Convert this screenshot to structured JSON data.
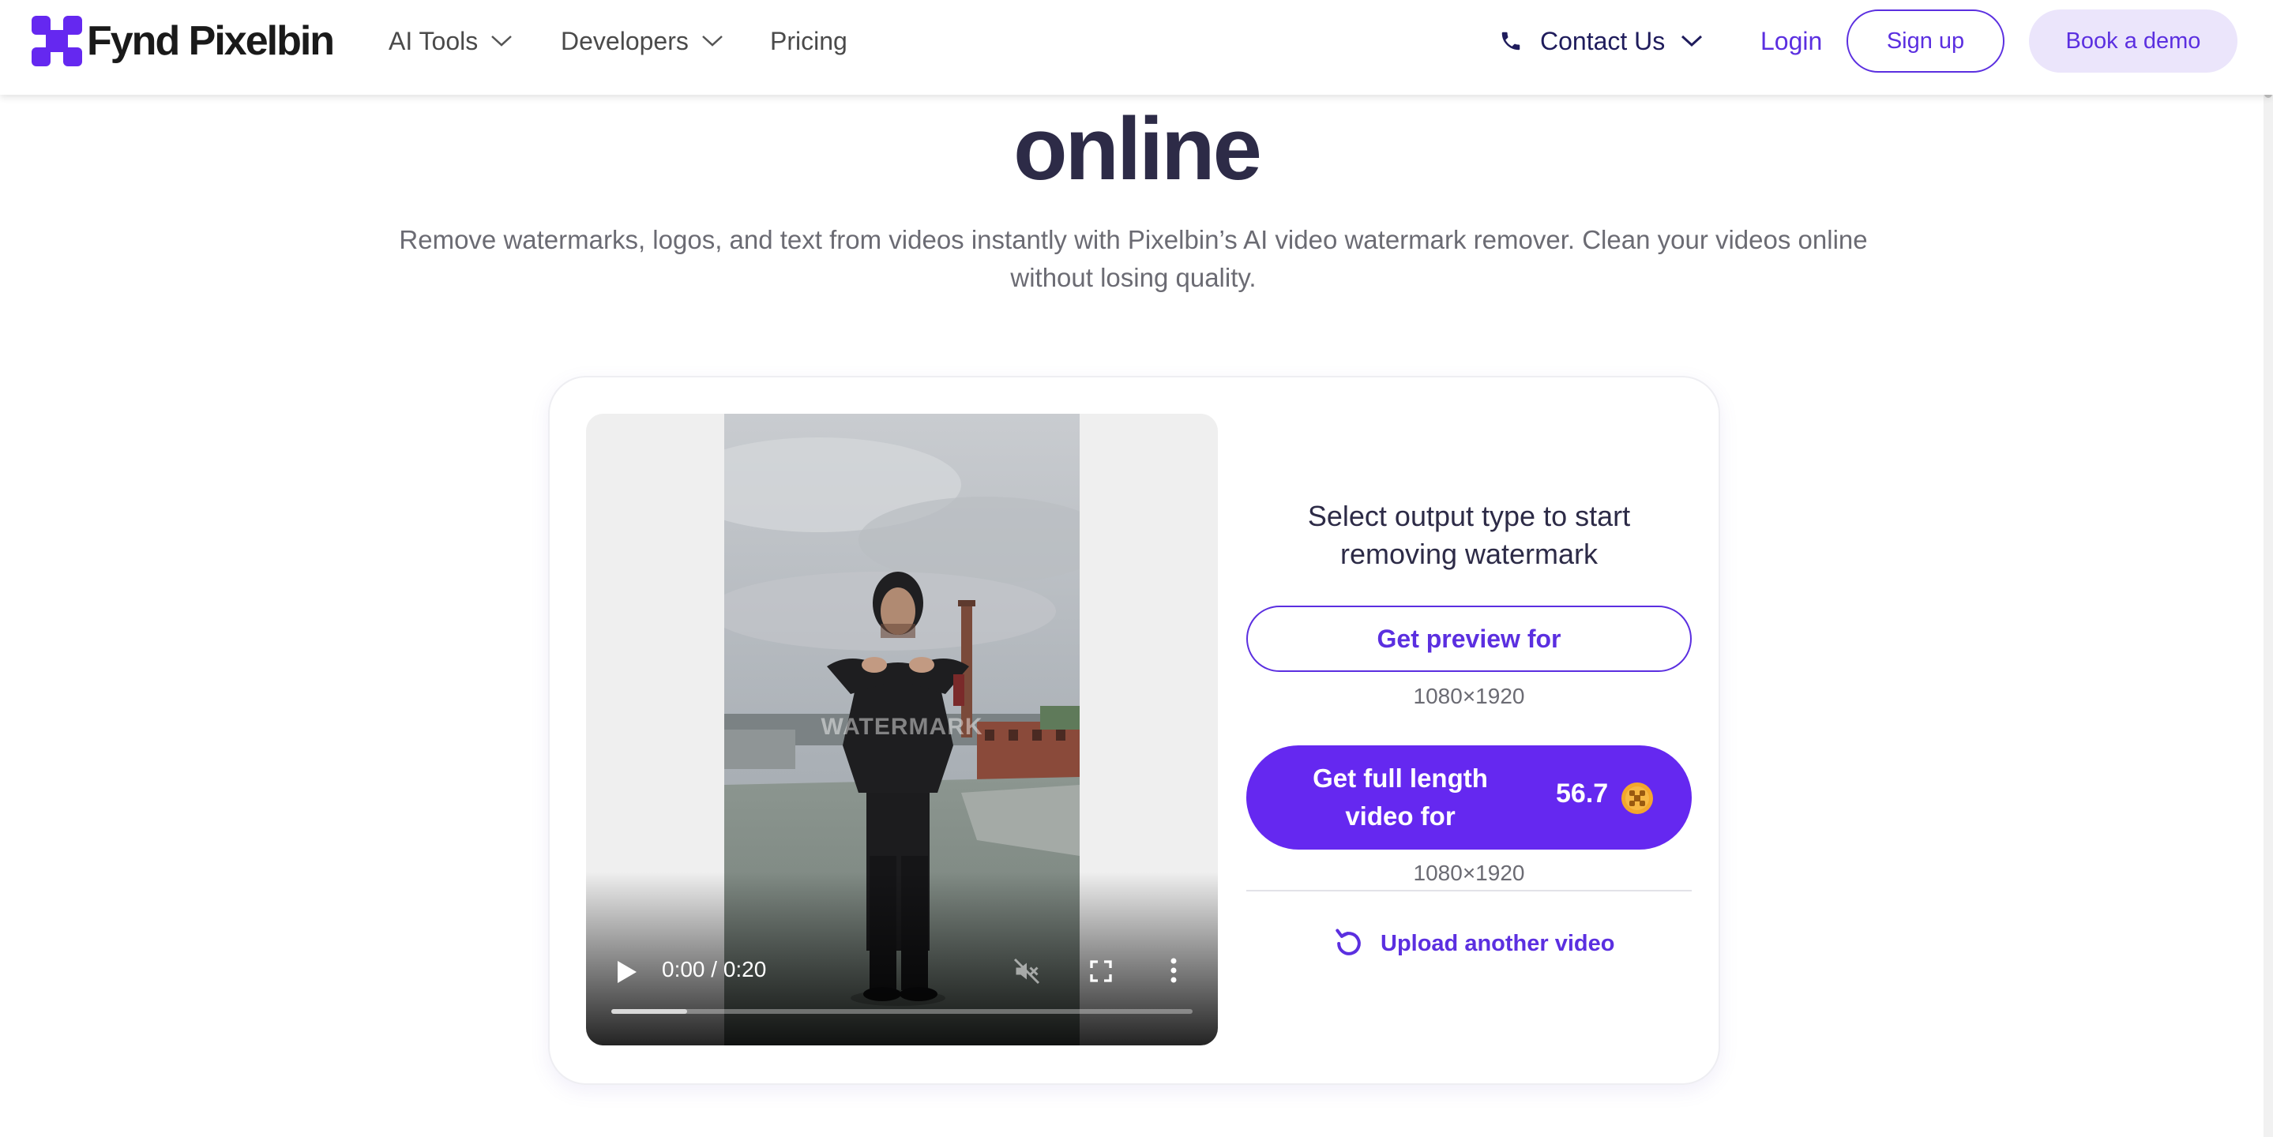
{
  "header": {
    "brand": "Fynd Pixelbin",
    "brand_color": "#6528f0",
    "nav": {
      "ai_tools": "AI Tools",
      "developers": "Developers",
      "pricing": "Pricing"
    },
    "contact": "Contact Us",
    "login": "Login",
    "signup": "Sign up",
    "book_demo": "Book a demo"
  },
  "hero": {
    "title_tail": "online",
    "subtitle": "Remove watermarks, logos, and text from videos instantly with Pixelbin’s AI video watermark remover. Clean your videos online without losing quality."
  },
  "player": {
    "time": "0:00 / 0:20",
    "watermark_text": "WATERMARK",
    "progress_fraction": 0.13
  },
  "options": {
    "title": "Select output type to start removing watermark",
    "preview_label": "Get preview for",
    "preview_resolution": "1080×1920",
    "full_label": "Get full length video for",
    "full_price": "56.7",
    "full_resolution": "1080×1920",
    "upload_another": "Upload another video"
  }
}
